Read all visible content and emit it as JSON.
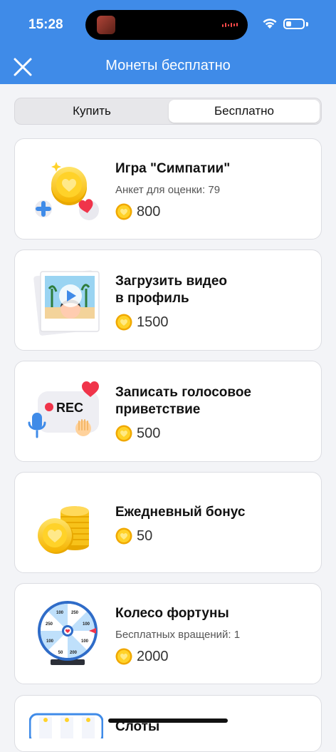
{
  "status_bar": {
    "time": "15:28"
  },
  "header": {
    "title": "Монеты бесплатно"
  },
  "tabs": [
    {
      "label": "Купить",
      "selected": false
    },
    {
      "label": "Бесплатно",
      "selected": true
    }
  ],
  "cards": [
    {
      "title": "Игра \"Симпатии\"",
      "subtitle": "Анкет для оценки: 79",
      "reward": "800",
      "icon": "sympathy-game-icon"
    },
    {
      "title_line1": "Загрузить видео",
      "title_line2": "в профиль",
      "reward": "1500",
      "icon": "video-profile-icon"
    },
    {
      "title_line1": "Записать голосовое",
      "title_line2": "приветствие",
      "reward": "500",
      "rec_label": "REC",
      "icon": "voice-greeting-icon"
    },
    {
      "title": "Ежедневный бонус",
      "reward": "50",
      "icon": "coin-stack-icon"
    },
    {
      "title": "Колесо фортуны",
      "subtitle": "Бесплатных вращений: 1",
      "reward": "2000",
      "icon": "fortune-wheel-icon",
      "wheel_labels": [
        "250",
        "100",
        "100",
        "200",
        "50",
        "100",
        "250",
        "100"
      ]
    },
    {
      "title": "Слоты",
      "icon": "slots-icon"
    }
  ],
  "colors": {
    "accent": "#3f8be8",
    "coin": "#f7c21a",
    "heart": "#f0344a"
  }
}
